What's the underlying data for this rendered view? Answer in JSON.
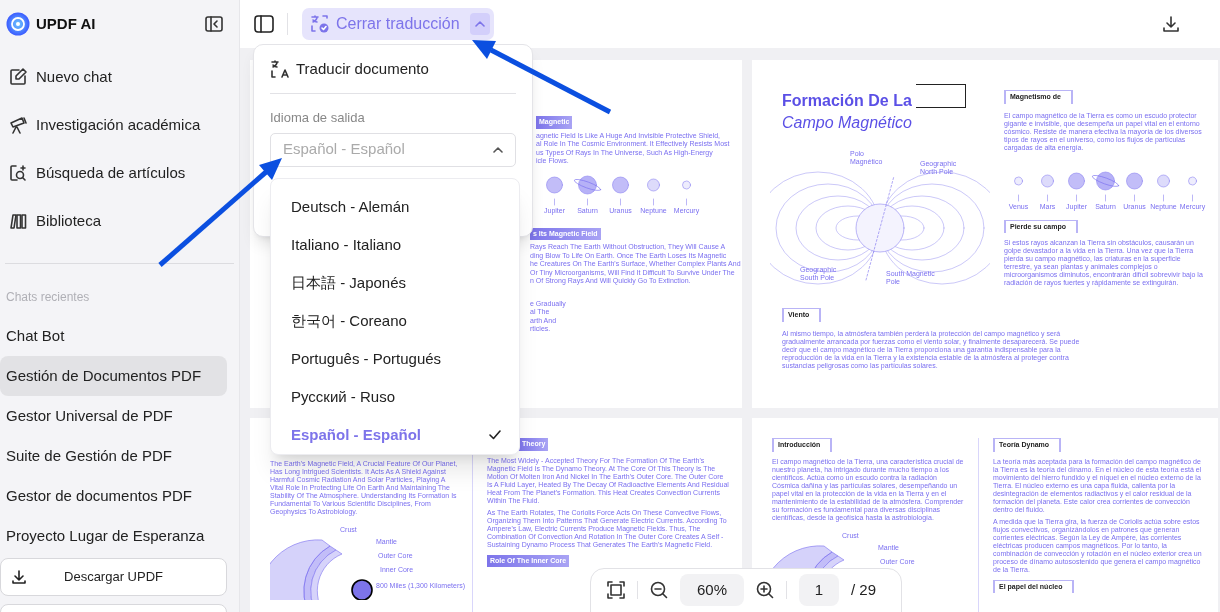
{
  "sidebar": {
    "app_name": "UPDF AI",
    "nav": [
      {
        "kind": "edit",
        "label": "Nuevo chat"
      },
      {
        "kind": "research",
        "label": "Investigación académica"
      },
      {
        "kind": "search",
        "label": "Búsqueda de artículos"
      },
      {
        "kind": "library",
        "label": "Biblioteca"
      }
    ],
    "recent_heading": "Chats recientes",
    "recent": [
      {
        "label": "Chat Bot",
        "selected": false
      },
      {
        "label": "Gestión de Documentos PDF",
        "selected": true
      },
      {
        "label": "Gestor Universal de PDF",
        "selected": false
      },
      {
        "label": "Suite de Gestión de PDF",
        "selected": false
      },
      {
        "label": "Gestor de documentos PDF",
        "selected": false
      },
      {
        "label": "Proyecto Lugar de Esperanza",
        "selected": false
      }
    ],
    "download_button": "Descargar UPDF"
  },
  "toolbar": {
    "translate_button": "Cerrar traducción",
    "expanded": true
  },
  "translate_popup": {
    "title": "Traducir documento",
    "output_label": "Idioma de salida",
    "select_value": "Español - Español",
    "options": [
      {
        "label": "Deutsch - Alemán",
        "selected": false
      },
      {
        "label": "Italiano - Italiano",
        "selected": false
      },
      {
        "label": "日本語 - Japonés",
        "selected": false
      },
      {
        "label": "한국어 - Coreano",
        "selected": false
      },
      {
        "label": "Português - Portugués",
        "selected": false
      },
      {
        "label": "Русский - Ruso",
        "selected": false
      },
      {
        "label": "Español - Español",
        "selected": true
      }
    ]
  },
  "pages": [
    {
      "kind": "cropped",
      "heading_1": "Magnetic",
      "lines_1": [
        "agnetic Field Is Like A Huge And Invisible Protective Shield,",
        "al Role In The Cosmic Environment. It Effectively Resists Most",
        "us Types Of Rays In The Universe, Such As High-Energy",
        "icle Flows."
      ],
      "planet_labels": [
        "Jupiter",
        "Saturn",
        "Uranus",
        "Neptune",
        "Mercury"
      ],
      "heading_2": "s Its Magnetic Field",
      "lines_2": [
        "Rays Reach The Earth Without Obstruction, They Will Cause A",
        "ding Blow To Life On Earth. Once The Earth Loses Its Magnetic",
        "he Creatures On The Earth's Surface, Whether Complex Plants And",
        "Or Tiny Microorganisms, Will Find It Difficult To Survive Under The",
        "n Of Strong Rays And Will Quickly Go To Extinction."
      ],
      "lines_3": [
        "e Gradually",
        "al The",
        "arth And",
        "rticles."
      ]
    },
    {
      "kind": "cover",
      "title": "Formación De La",
      "subtitle": "Campo Magnético",
      "diagram_labels": [
        "Polo Magnético",
        "Geographic North Pole",
        "Geographic South Pole",
        "South Magnetic Pole"
      ],
      "sections": [
        {
          "heading": "Magnetismo de",
          "text": "El campo magnético de la Tierra es como un escudo protector gigante e invisible, que desempeña un papel vital en el entorno cósmico. Resiste de manera efectiva la mayoría de los diversos tipos de rayos en el universo, como los flujos de partículas cargadas de alta energía."
        },
        {
          "heading": "Pierde su campo",
          "text": "Si estos rayos alcanzan la Tierra sin obstáculos, causarán un golpe devastador a la vida en la Tierra. Una vez que la Tierra pierda su campo magnético, las criaturas en la superficie terrestre, ya sean plantas y animales complejos o microorganismos diminutos, encontrarán difícil sobrevivir bajo la radiación de rayos fuertes y rápidamente se extinguirán."
        },
        {
          "heading": "Viento",
          "text": "Al mismo tiempo, la atmósfera también perderá la protección del campo magnético y será gradualmente arrancada por fuerzas como el viento solar, y finalmente desaparecerá. Se puede decir que el campo magnético de la Tierra proporciona una garantía indispensable para la reproducción de la vida en la Tierra y la existencia estable de la atmósfera al proteger contra sustancias peligrosas como las partículas solares."
        }
      ],
      "planet_labels": [
        "Venus",
        "Mars",
        "Jupiter",
        "Saturn",
        "Uranus",
        "Neptune",
        "Mercury"
      ]
    },
    {
      "kind": "tagged",
      "left": {
        "paragraphs": [
          "The Earth's Magnetic Field, A Crucial Feature Of Our Planet, Has Long Intrigued Scientists. It Acts As A Shield Against Harmful Cosmic Radiation And Solar Particles, Playing A Vital Role In Protecting Life On Earth And Maintaining The Stability Of The Atmosphere. Understanding Its Formation Is Fundamental To Various Scientific Disciplines, From Geophysics To Astrobiology."
        ],
        "layer_labels": [
          "Crust",
          "Mantle",
          "Outer Core",
          "Inner Core",
          "800 Miles (1,300 Kilometers)"
        ]
      },
      "right": {
        "heading": "Theory",
        "paragraphs": [
          "The Most Widely - Accepted Theory For The Formation Of The Earth's Magnetic Field Is The Dynamo Theory. At The Core Of This Theory Is The Motion Of Molten Iron And Nickel In The Earth's Outer Core. The Outer Core Is A Fluid Layer, Heated By The Decay Of Radioactive Elements And Residual Heat From The Planet's Formation. This Heat Creates Convection Currents Within The Fluid.",
          "As The Earth Rotates, The Coriolis Force Acts On These Convective Flows, Organizing Them Into Patterns That Generate Electric Currents. According To Ampere's Law, Electric Currents Produce Magnetic Fields. Thus, The Combination Of Convection And Rotation In The Outer Core Creates A Self - Sustaining Dynamo Process That Generates The Earth's Magnetic Field."
        ],
        "heading_2": "Role Of The Inner Core"
      }
    },
    {
      "kind": "outlined",
      "left": {
        "heading": "Introducción",
        "paragraphs": [
          "El campo magnético de la Tierra, una característica crucial de nuestro planeta, ha intrigado durante mucho tiempo a los científicos. Actúa como un escudo contra la radiación Cósmica dañina y las partículas solares, desempeñando un papel vital en la protección de la vida en la Tierra y en el mantenimiento de la estabilidad de la atmósfera. Comprender su formación es fundamental para diversas disciplinas científicas, desde la geofísica hasta la astrobiología."
        ],
        "layer_labels": [
          "Crust",
          "Mantle",
          "Outer Core"
        ]
      },
      "right": {
        "heading": "Teoría Dynamo",
        "paragraphs": [
          "La teoría más aceptada para la formación del campo magnético de la Tierra es la teoría del dínamo. En el núcleo de esta teoría está el movimiento del hierro fundido y el níquel en el núcleo externo de la Tierra. El núcleo externo es una capa fluida, calienta por la desintegración de elementos radiactivos y el calor residual de la formación del planeta. Este calor crea corrientes de convección dentro del fluido.",
          "A medida que la Tierra gira, la fuerza de Coriolis actúa sobre estos flujos convectivos, organizándolos en patrones que generan corrientes eléctricas. Según la Ley de Ampère, las corrientes eléctricas producen campos magnéticos. Por lo tanto, la combinación de convección y rotación en el núcleo exterior crea un proceso de dínamo autosostenido que genera el campo magnético de la Tierra."
        ],
        "heading_2": "El papel del núcleo"
      }
    }
  ],
  "zoom_bar": {
    "zoom": "60%",
    "page": "1",
    "total": "/ 29"
  }
}
